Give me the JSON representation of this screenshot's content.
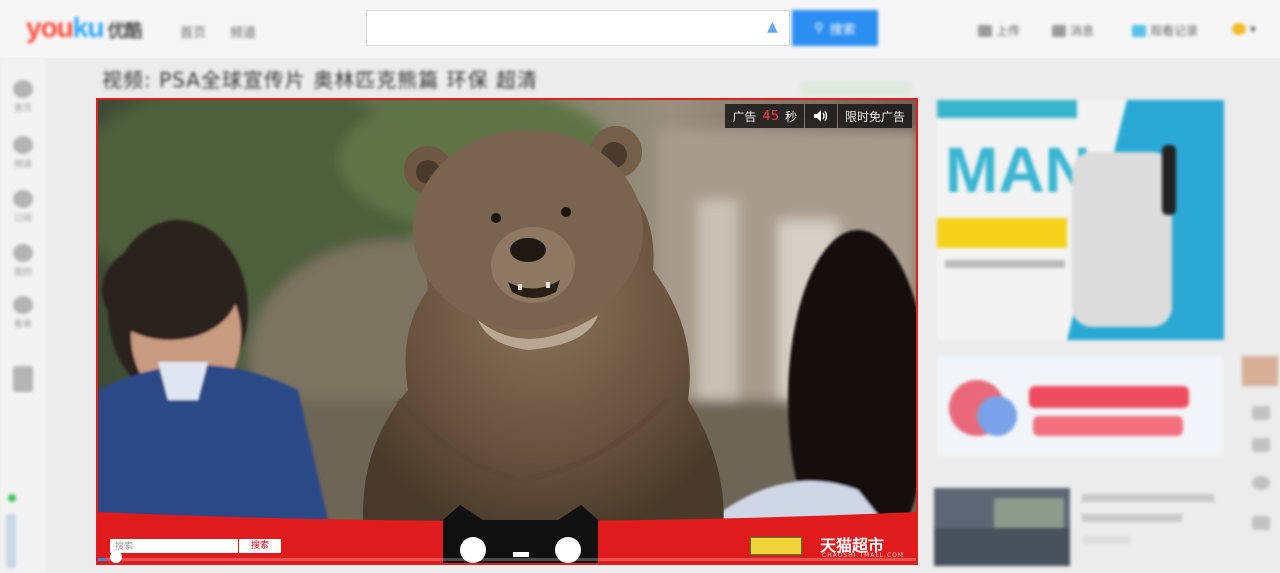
{
  "header": {
    "logo_you": "you",
    "logo_ku": "ku",
    "logo_sub": "优酷",
    "nav": [
      "首页",
      "频道"
    ],
    "search": {
      "placeholder": "",
      "button_label": "搜索"
    },
    "right_links": [
      "上传",
      "消息",
      "观看记录",
      ""
    ]
  },
  "left_rail": [
    "首页",
    "频道",
    "订阅",
    "我的",
    "看单"
  ],
  "page_title": "视频: PSA全球宣传片 奥林匹克熊篇 环保 超清",
  "ad_overlay": {
    "label": "广告",
    "seconds": "45",
    "unit": "秒",
    "skip_label": "限时免广告"
  },
  "tmall": {
    "search_placeholder": "搜索",
    "search_button": "搜索",
    "brand": "天猫超市",
    "brand_sub": "CHAOSHI.TMALL.COM"
  },
  "player": {
    "progress": 0.01
  },
  "colors": {
    "accent": "#e51d1d",
    "brand_blue": "#2b8ef0",
    "tmall_red": "#e01b1b"
  }
}
